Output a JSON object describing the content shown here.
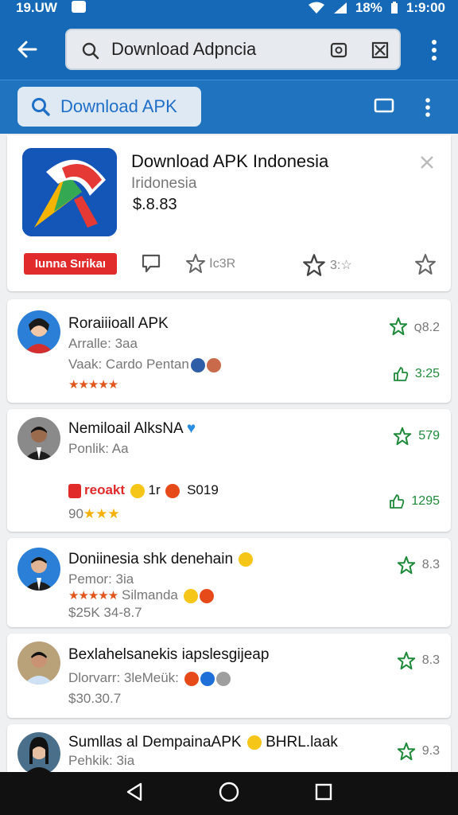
{
  "status_bar": {
    "time_left": "19.UW",
    "battery": "18%",
    "clock": "1:9:00"
  },
  "search": {
    "value": "Download Adpncia",
    "placeholder": ""
  },
  "sub_bar": {
    "pill_label": "Download APK"
  },
  "hero": {
    "title": "Download APK Indonesia",
    "subtitle": "Iridonesia",
    "price": "$.8.83",
    "badge": "Iunna Sırikaı",
    "stat1": "Ⅰc3R",
    "stat2": "3:☆"
  },
  "reviews": [
    {
      "name": "Roraiiioall APK",
      "line1": "Arralle: 3aa",
      "line2": "Vaak: Cardo Pentan",
      "stat_top": "ꞯ8.2",
      "stat_bottom": "3:25"
    },
    {
      "name": "Nemiloail AlksNA",
      "line1": "Ponlik: Aa",
      "tag": "reoakt",
      "tag_extra": "1r",
      "tag_num": "S019",
      "line3": "90",
      "stat_top": "579",
      "stat_bottom": "1295"
    },
    {
      "name": "Doniinesia shk denehain",
      "line1": "Pemor: 3ia",
      "line2": "Silmanda",
      "line3": "$25K 34-8.7",
      "stat_top": "8.3"
    },
    {
      "name": "Bexlahelsanekis iapslesgijeap",
      "line1": "Dlorvarr: 3leMeük:",
      "line3": "$30.30.7",
      "stat_top": "8.3"
    },
    {
      "name": "Sumllas al DempainaAPK",
      "name_tail": "BHRL.laak",
      "line1": "Pehkik: 3ia",
      "stat_top": "9.3"
    }
  ],
  "colors": {
    "primary": "#1569b6",
    "accent_green": "#1e8a3a",
    "badge_red": "#e12a2a",
    "star_orange": "#e0561c"
  }
}
